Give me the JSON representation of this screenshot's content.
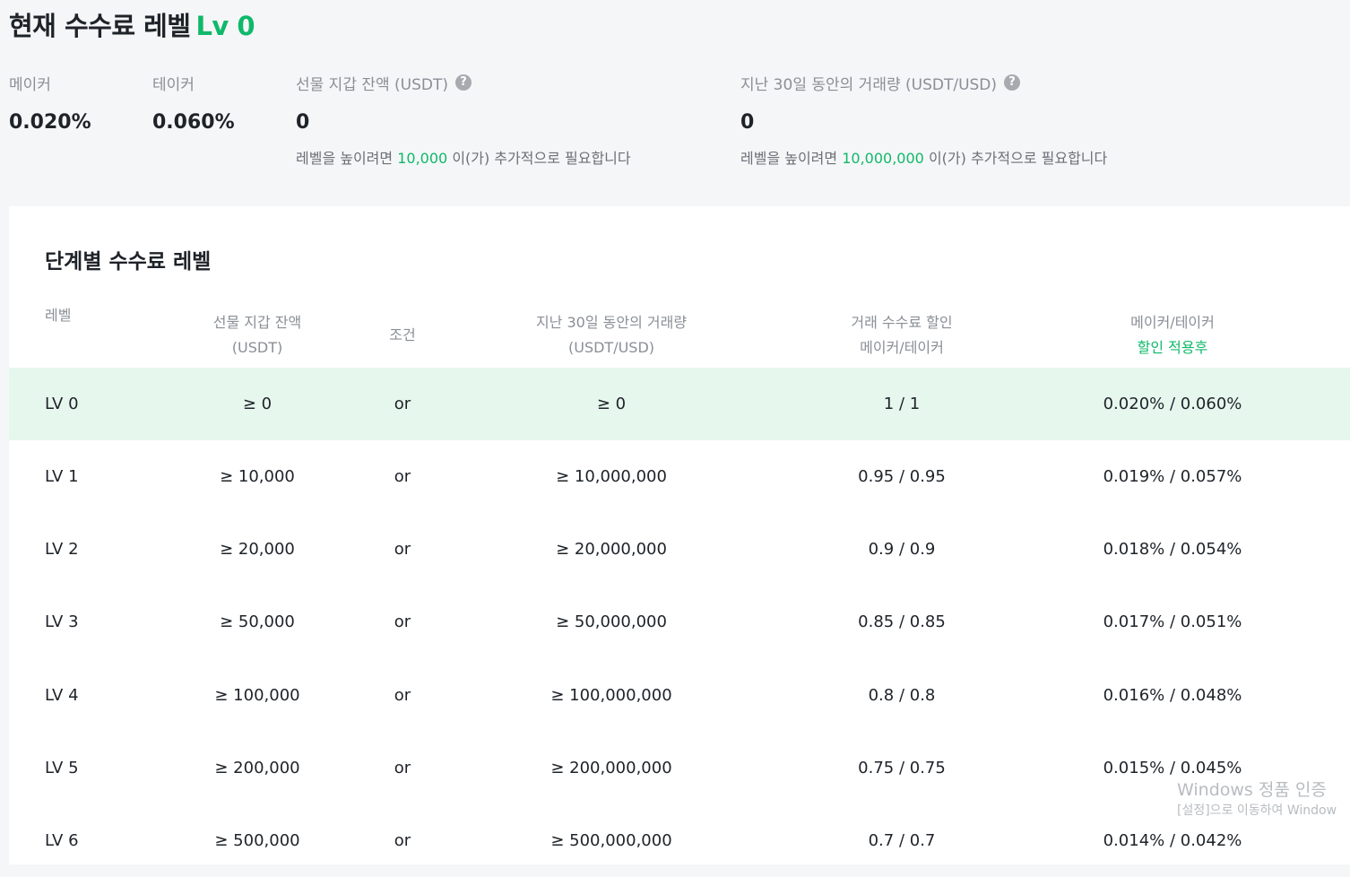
{
  "header": {
    "title": "현재 수수료 레벨",
    "level": "Lv 0"
  },
  "stats": {
    "maker": {
      "label": "메이커",
      "value": "0.020%"
    },
    "taker": {
      "label": "테이커",
      "value": "0.060%"
    },
    "balance": {
      "label": "선물 지갑 잔액 (USDT)",
      "value": "0",
      "note_prefix": "레벨을 높이려면",
      "note_amount": "10,000",
      "note_suffix": "이(가) 추가적으로 필요합니다"
    },
    "volume": {
      "label": "지난 30일 동안의 거래량 (USDT/USD)",
      "value": "0",
      "note_prefix": "레벨을 높이려면",
      "note_amount": "10,000,000",
      "note_suffix": "이(가) 추가적으로 필요합니다"
    }
  },
  "table": {
    "title": "단계별 수수료 레벨",
    "headers": {
      "level": "레벨",
      "balance_1": "선물 지갑 잔액",
      "balance_2": "(USDT)",
      "condition": "조건",
      "volume_1": "지난 30일 동안의 거래량",
      "volume_2": "(USDT/USD)",
      "discount_1": "거래 수수료 할인",
      "discount_2": "메이커/테이커",
      "fee_1": "메이커/테이커",
      "fee_2": "할인 적용후"
    },
    "rows": [
      {
        "level": "LV 0",
        "balance": "≥ 0",
        "condition": "or",
        "volume": "≥ 0",
        "discount": "1 / 1",
        "fee": "0.020% / 0.060%"
      },
      {
        "level": "LV 1",
        "balance": "≥ 10,000",
        "condition": "or",
        "volume": "≥ 10,000,000",
        "discount": "0.95 / 0.95",
        "fee": "0.019% / 0.057%"
      },
      {
        "level": "LV 2",
        "balance": "≥ 20,000",
        "condition": "or",
        "volume": "≥ 20,000,000",
        "discount": "0.9 / 0.9",
        "fee": "0.018% / 0.054%"
      },
      {
        "level": "LV 3",
        "balance": "≥ 50,000",
        "condition": "or",
        "volume": "≥ 50,000,000",
        "discount": "0.85 / 0.85",
        "fee": "0.017% / 0.051%"
      },
      {
        "level": "LV 4",
        "balance": "≥ 100,000",
        "condition": "or",
        "volume": "≥ 100,000,000",
        "discount": "0.8 / 0.8",
        "fee": "0.016% / 0.048%"
      },
      {
        "level": "LV 5",
        "balance": "≥ 200,000",
        "condition": "or",
        "volume": "≥ 200,000,000",
        "discount": "0.75 / 0.75",
        "fee": "0.015% / 0.045%"
      },
      {
        "level": "LV 6",
        "balance": "≥ 500,000",
        "condition": "or",
        "volume": "≥ 500,000,000",
        "discount": "0.7 / 0.7",
        "fee": "0.014% / 0.042%"
      }
    ]
  },
  "watermark": {
    "line1": "Windows 정품 인증",
    "line2": "[설정]으로 이동하여 Window"
  },
  "colors": {
    "accent": "#10b86a",
    "active_row": "#e6f7ee",
    "muted": "#8a8f96"
  }
}
